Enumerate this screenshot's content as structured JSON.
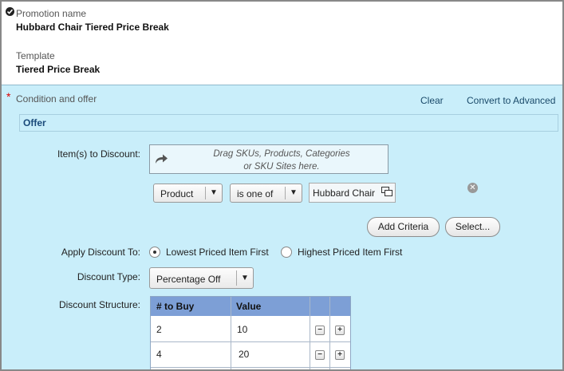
{
  "header": {
    "promotion_name_label": "Promotion name",
    "promotion_name_value": "Hubbard Chair Tiered Price Break",
    "template_label": "Template",
    "template_value": "Tiered Price Break"
  },
  "condition": {
    "required_mark": "*",
    "title": "Condition and offer",
    "clear_link": "Clear",
    "convert_link": "Convert to Advanced",
    "offer_title": "Offer"
  },
  "items_to_discount": {
    "label": "Item(s) to Discount:",
    "drop_line1": "Drag SKUs, Products, Categories",
    "drop_line2": "or SKU Sites here."
  },
  "criteria": {
    "field_select": "Product",
    "operator_select": "is one of",
    "value_chip": "Hubbard Chair",
    "add_criteria_button": "Add Criteria",
    "select_button": "Select..."
  },
  "apply_discount": {
    "label": "Apply Discount To:",
    "option_lowest": "Lowest Priced Item First",
    "option_highest": "Highest Priced Item First",
    "selected": "lowest"
  },
  "discount_type": {
    "label": "Discount Type:",
    "value": "Percentage Off"
  },
  "discount_structure": {
    "label": "Discount Structure:",
    "columns": [
      "# to Buy",
      "Value"
    ],
    "rows": [
      {
        "to_buy": "2",
        "value": "10"
      },
      {
        "to_buy": "4",
        "value": "20"
      }
    ]
  },
  "icons": {
    "check": "check-circle-icon",
    "drag": "share-arrow-icon",
    "browse": "window-icon",
    "remove": "remove-circle-icon",
    "remove_row": "minus-icon",
    "add_row": "plus-icon"
  }
}
